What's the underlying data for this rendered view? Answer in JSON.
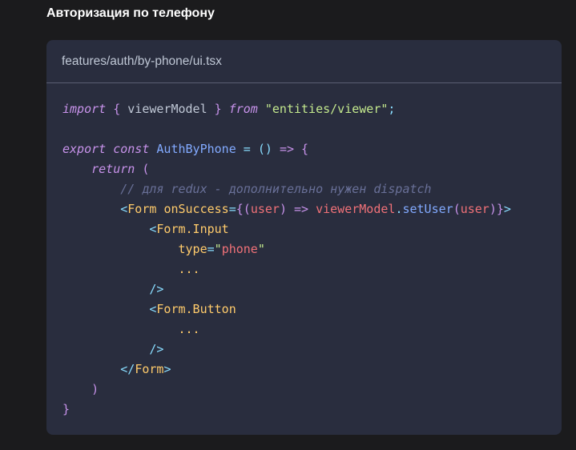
{
  "page": {
    "heading": "Авторизация по телефону"
  },
  "code_block": {
    "filename": "features/auth/by-phone/ui.tsx",
    "language": "tsx",
    "lines": [
      "import { viewerModel } from \"entities/viewer\";",
      "",
      "export const AuthByPhone = () => {",
      "    return (",
      "        // для redux - дополнительно нужен dispatch",
      "        <Form onSuccess={(user) => viewerModel.setUser(user)}>",
      "            <Form.Input",
      "                type=\"phone\"",
      "                ...",
      "            />",
      "            <Form.Button",
      "                ...",
      "            />",
      "        </Form>",
      "    )",
      "}"
    ],
    "tokens": {
      "l1": [
        "import",
        " ",
        "{",
        " viewerModel ",
        "}",
        " ",
        "from",
        " ",
        "\"entities/viewer\"",
        ";"
      ],
      "l3": [
        "export",
        " ",
        "const",
        " ",
        "AuthByPhone",
        " ",
        "=",
        " ",
        "()",
        " ",
        "=>",
        " ",
        "{"
      ],
      "l4": [
        "    ",
        "return",
        " ",
        "("
      ],
      "l5": [
        "        ",
        "// для redux - дополнительно нужен dispatch"
      ],
      "l6": [
        "        ",
        "<",
        "Form",
        " ",
        "onSuccess",
        "=",
        "{",
        "(",
        "user",
        ")",
        " ",
        "=>",
        " ",
        "viewerModel",
        ".",
        "setUser",
        "(",
        "user",
        ")",
        "}",
        ">"
      ],
      "l7": [
        "            ",
        "<",
        "Form.Input"
      ],
      "l8": [
        "                ",
        "type",
        "=",
        "\"",
        "phone",
        "\""
      ],
      "l9": [
        "                ",
        "..."
      ],
      "l10": [
        "            ",
        "/>"
      ],
      "l11": [
        "            ",
        "<",
        "Form.Button"
      ],
      "l12": [
        "                ",
        "..."
      ],
      "l13": [
        "            ",
        "/>"
      ],
      "l14": [
        "        ",
        "</",
        "Form",
        ">"
      ],
      "l15": [
        "    ",
        ")"
      ],
      "l16": [
        "}"
      ]
    }
  },
  "colors": {
    "page_background": "#1b1b1d",
    "code_background": "#292d3e",
    "keyword": "#c792ea",
    "string": "#c3e88d",
    "function": "#82aaff",
    "operator": "#89ddff",
    "comment": "#697098",
    "tag": "#ffcb6b",
    "variable": "#f07178"
  }
}
